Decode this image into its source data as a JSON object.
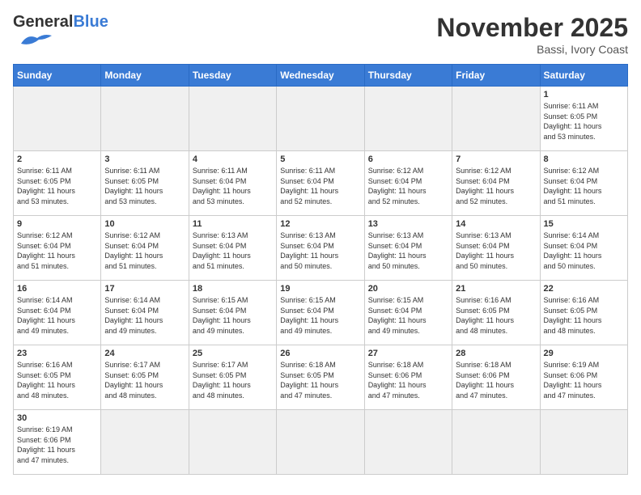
{
  "header": {
    "logo_general": "General",
    "logo_blue": "Blue",
    "month_title": "November 2025",
    "location": "Bassi, Ivory Coast"
  },
  "days_of_week": [
    "Sunday",
    "Monday",
    "Tuesday",
    "Wednesday",
    "Thursday",
    "Friday",
    "Saturday"
  ],
  "weeks": [
    [
      {
        "day": "",
        "info": ""
      },
      {
        "day": "",
        "info": ""
      },
      {
        "day": "",
        "info": ""
      },
      {
        "day": "",
        "info": ""
      },
      {
        "day": "",
        "info": ""
      },
      {
        "day": "",
        "info": ""
      },
      {
        "day": "1",
        "info": "Sunrise: 6:11 AM\nSunset: 6:05 PM\nDaylight: 11 hours\nand 53 minutes."
      }
    ],
    [
      {
        "day": "2",
        "info": "Sunrise: 6:11 AM\nSunset: 6:05 PM\nDaylight: 11 hours\nand 53 minutes."
      },
      {
        "day": "3",
        "info": "Sunrise: 6:11 AM\nSunset: 6:05 PM\nDaylight: 11 hours\nand 53 minutes."
      },
      {
        "day": "4",
        "info": "Sunrise: 6:11 AM\nSunset: 6:04 PM\nDaylight: 11 hours\nand 53 minutes."
      },
      {
        "day": "5",
        "info": "Sunrise: 6:11 AM\nSunset: 6:04 PM\nDaylight: 11 hours\nand 52 minutes."
      },
      {
        "day": "6",
        "info": "Sunrise: 6:12 AM\nSunset: 6:04 PM\nDaylight: 11 hours\nand 52 minutes."
      },
      {
        "day": "7",
        "info": "Sunrise: 6:12 AM\nSunset: 6:04 PM\nDaylight: 11 hours\nand 52 minutes."
      },
      {
        "day": "8",
        "info": "Sunrise: 6:12 AM\nSunset: 6:04 PM\nDaylight: 11 hours\nand 51 minutes."
      }
    ],
    [
      {
        "day": "9",
        "info": "Sunrise: 6:12 AM\nSunset: 6:04 PM\nDaylight: 11 hours\nand 51 minutes."
      },
      {
        "day": "10",
        "info": "Sunrise: 6:12 AM\nSunset: 6:04 PM\nDaylight: 11 hours\nand 51 minutes."
      },
      {
        "day": "11",
        "info": "Sunrise: 6:13 AM\nSunset: 6:04 PM\nDaylight: 11 hours\nand 51 minutes."
      },
      {
        "day": "12",
        "info": "Sunrise: 6:13 AM\nSunset: 6:04 PM\nDaylight: 11 hours\nand 50 minutes."
      },
      {
        "day": "13",
        "info": "Sunrise: 6:13 AM\nSunset: 6:04 PM\nDaylight: 11 hours\nand 50 minutes."
      },
      {
        "day": "14",
        "info": "Sunrise: 6:13 AM\nSunset: 6:04 PM\nDaylight: 11 hours\nand 50 minutes."
      },
      {
        "day": "15",
        "info": "Sunrise: 6:14 AM\nSunset: 6:04 PM\nDaylight: 11 hours\nand 50 minutes."
      }
    ],
    [
      {
        "day": "16",
        "info": "Sunrise: 6:14 AM\nSunset: 6:04 PM\nDaylight: 11 hours\nand 49 minutes."
      },
      {
        "day": "17",
        "info": "Sunrise: 6:14 AM\nSunset: 6:04 PM\nDaylight: 11 hours\nand 49 minutes."
      },
      {
        "day": "18",
        "info": "Sunrise: 6:15 AM\nSunset: 6:04 PM\nDaylight: 11 hours\nand 49 minutes."
      },
      {
        "day": "19",
        "info": "Sunrise: 6:15 AM\nSunset: 6:04 PM\nDaylight: 11 hours\nand 49 minutes."
      },
      {
        "day": "20",
        "info": "Sunrise: 6:15 AM\nSunset: 6:04 PM\nDaylight: 11 hours\nand 49 minutes."
      },
      {
        "day": "21",
        "info": "Sunrise: 6:16 AM\nSunset: 6:05 PM\nDaylight: 11 hours\nand 48 minutes."
      },
      {
        "day": "22",
        "info": "Sunrise: 6:16 AM\nSunset: 6:05 PM\nDaylight: 11 hours\nand 48 minutes."
      }
    ],
    [
      {
        "day": "23",
        "info": "Sunrise: 6:16 AM\nSunset: 6:05 PM\nDaylight: 11 hours\nand 48 minutes."
      },
      {
        "day": "24",
        "info": "Sunrise: 6:17 AM\nSunset: 6:05 PM\nDaylight: 11 hours\nand 48 minutes."
      },
      {
        "day": "25",
        "info": "Sunrise: 6:17 AM\nSunset: 6:05 PM\nDaylight: 11 hours\nand 48 minutes."
      },
      {
        "day": "26",
        "info": "Sunrise: 6:18 AM\nSunset: 6:05 PM\nDaylight: 11 hours\nand 47 minutes."
      },
      {
        "day": "27",
        "info": "Sunrise: 6:18 AM\nSunset: 6:06 PM\nDaylight: 11 hours\nand 47 minutes."
      },
      {
        "day": "28",
        "info": "Sunrise: 6:18 AM\nSunset: 6:06 PM\nDaylight: 11 hours\nand 47 minutes."
      },
      {
        "day": "29",
        "info": "Sunrise: 6:19 AM\nSunset: 6:06 PM\nDaylight: 11 hours\nand 47 minutes."
      }
    ],
    [
      {
        "day": "30",
        "info": "Sunrise: 6:19 AM\nSunset: 6:06 PM\nDaylight: 11 hours\nand 47 minutes."
      },
      {
        "day": "",
        "info": ""
      },
      {
        "day": "",
        "info": ""
      },
      {
        "day": "",
        "info": ""
      },
      {
        "day": "",
        "info": ""
      },
      {
        "day": "",
        "info": ""
      },
      {
        "day": "",
        "info": ""
      }
    ]
  ]
}
